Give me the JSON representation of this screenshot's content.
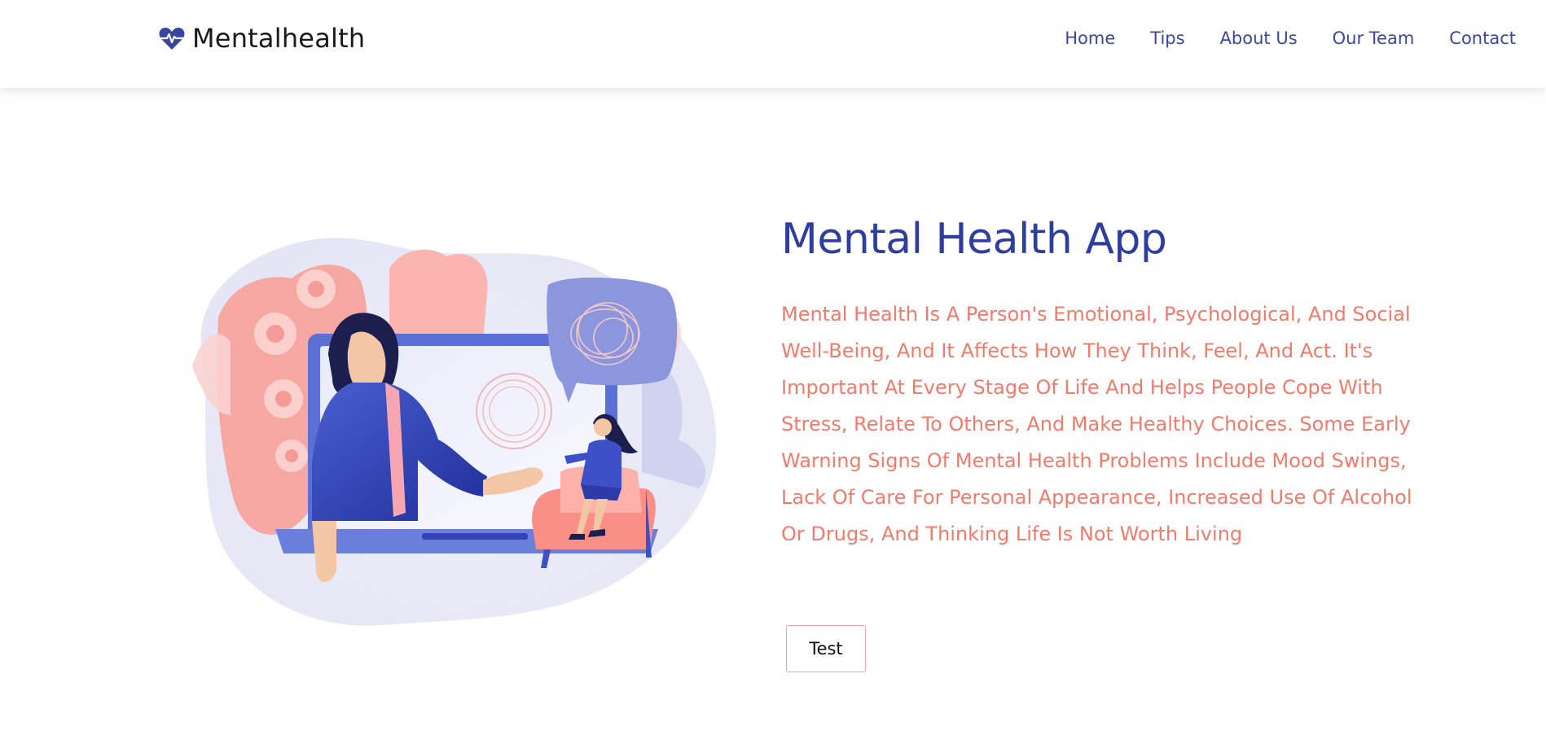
{
  "brand": {
    "name": "Mentalhealth",
    "icon": "heart-pulse-icon"
  },
  "nav": {
    "links": [
      "Home",
      "Tips",
      "About Us",
      "Our Team",
      "Contact"
    ]
  },
  "hero": {
    "title": "Mental Health App",
    "description": "Mental Health Is A Person's Emotional, Psychological, And Social Well-Being, And It Affects How They Think, Feel, And Act. It's Important At Every Stage Of Life And Helps People Cope With Stress, Relate To Others, And Make Healthy Choices. Some Early Warning Signs Of Mental Health Problems Include Mood Swings, Lack Of Care For Personal Appearance, Increased Use Of Alcohol Or Drugs, And Thinking Life Is Not Worth Living",
    "button_label": "Test"
  },
  "colors": {
    "primary": "#2f3e9e",
    "accent": "#ef7b6d",
    "button_border": "#f0a3ae"
  }
}
